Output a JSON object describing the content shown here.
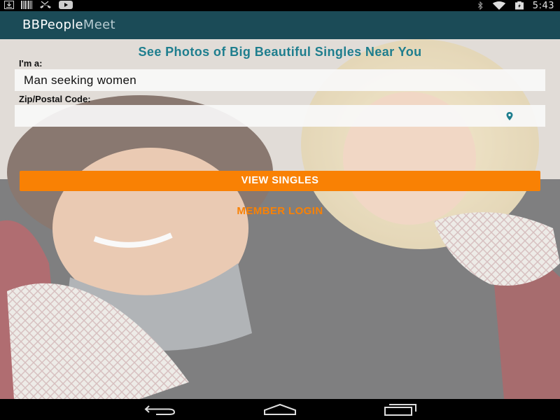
{
  "status_bar": {
    "time": "5:43",
    "left_icons": [
      "download-icon",
      "barcode-icon",
      "missed-call-icon",
      "youtube-icon"
    ],
    "right_icons": [
      "bluetooth-icon",
      "wifi-icon",
      "battery-charging-icon"
    ]
  },
  "action_bar": {
    "title_bold": "BBPeople",
    "title_light": "Meet"
  },
  "main": {
    "headline": "See Photos of Big Beautiful Singles Near You",
    "iam_label": "I'm a:",
    "seeking_value": "Man seeking women",
    "zip_label": "Zip/Postal Code:",
    "zip_value": "",
    "location_icon": "location-pin-icon",
    "view_button": "VIEW SINGLES",
    "login_link": "MEMBER LOGIN"
  },
  "nav_bar": {
    "buttons": [
      "back-icon",
      "home-icon",
      "recent-apps-icon"
    ]
  },
  "colors": {
    "action_bar": "#1b4b57",
    "headline": "#1e7e8e",
    "accent_orange": "#f98104"
  }
}
